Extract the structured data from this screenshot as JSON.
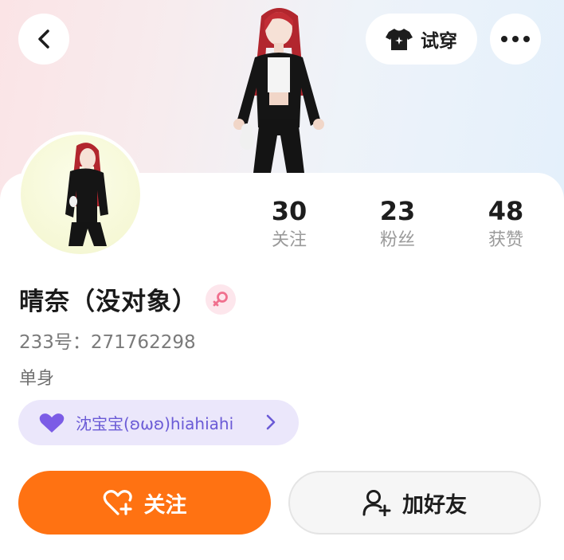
{
  "header": {
    "tryon_label": "试穿"
  },
  "stats": [
    {
      "value": "30",
      "label": "关注"
    },
    {
      "value": "23",
      "label": "粉丝"
    },
    {
      "value": "48",
      "label": "获赞"
    }
  ],
  "profile": {
    "name": "晴奈（没对象）",
    "gender": "female",
    "id_line": "233号：271762298",
    "status": "单身"
  },
  "partner": {
    "text": "沈宝宝(ʚωʚ)hiahiahi",
    "heart_color": "#7b5ce6"
  },
  "actions": {
    "follow_label": "关注",
    "add_friend_label": "加好友",
    "follow_color": "#ff7212"
  },
  "icons": {
    "back": "chevron-left-icon",
    "tryon": "tshirt-sparkle-icon",
    "more": "more-dots-icon",
    "gender": "female-icon",
    "follow": "heart-plus-icon",
    "add_friend": "user-plus-icon"
  }
}
